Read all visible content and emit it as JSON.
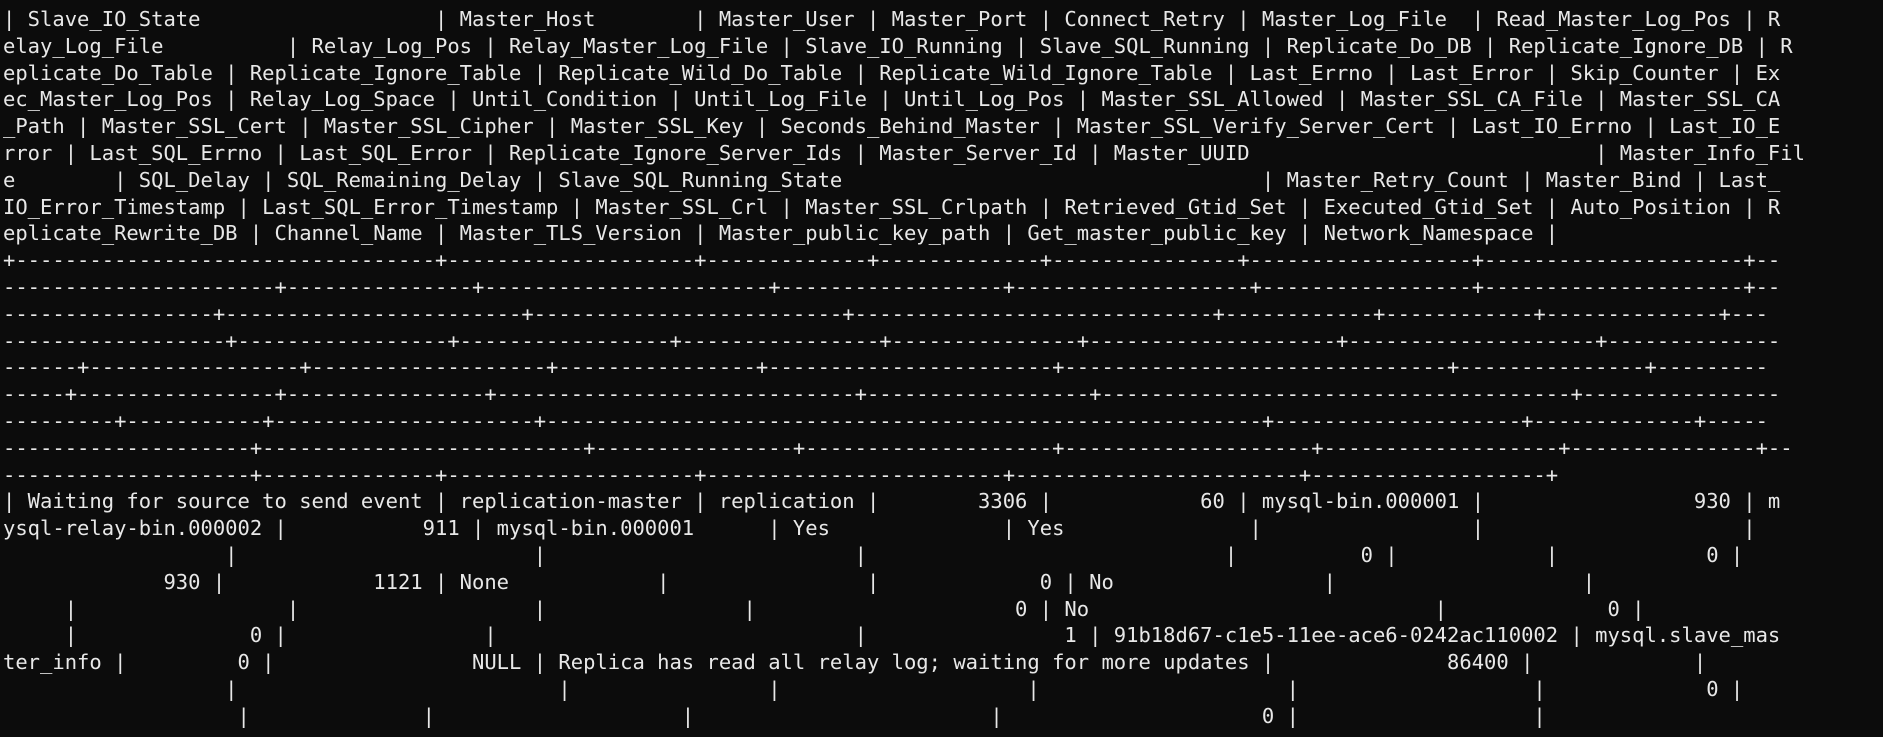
{
  "terminal": {
    "background": "#0c0c0c",
    "foreground": "#e8e8e8",
    "lines": [
      "| Slave_IO_State                   | Master_Host        | Master_User | Master_Port | Connect_Retry | Master_Log_File  | Read_Master_Log_Pos | R",
      "elay_Log_File          | Relay_Log_Pos | Relay_Master_Log_File | Slave_IO_Running | Slave_SQL_Running | Replicate_Do_DB | Replicate_Ignore_DB | R",
      "eplicate_Do_Table | Replicate_Ignore_Table | Replicate_Wild_Do_Table | Replicate_Wild_Ignore_Table | Last_Errno | Last_Error | Skip_Counter | Ex",
      "ec_Master_Log_Pos | Relay_Log_Space | Until_Condition | Until_Log_File | Until_Log_Pos | Master_SSL_Allowed | Master_SSL_CA_File | Master_SSL_CA",
      "_Path | Master_SSL_Cert | Master_SSL_Cipher | Master_SSL_Key | Seconds_Behind_Master | Master_SSL_Verify_Server_Cert | Last_IO_Errno | Last_IO_E",
      "rror | Last_SQL_Errno | Last_SQL_Error | Replicate_Ignore_Server_Ids | Master_Server_Id | Master_UUID                            | Master_Info_Fil",
      "e        | SQL_Delay | SQL_Remaining_Delay | Slave_SQL_Running_State                                  | Master_Retry_Count | Master_Bind | Last_",
      "IO_Error_Timestamp | Last_SQL_Error_Timestamp | Master_SSL_Crl | Master_SSL_Crlpath | Retrieved_Gtid_Set | Executed_Gtid_Set | Auto_Position | R",
      "eplicate_Rewrite_DB | Channel_Name | Master_TLS_Version | Master_public_key_path | Get_master_public_key | Network_Namespace |",
      "+----------------------------------+--------------------+-------------+-------------+---------------+------------------+---------------------+--",
      "----------------------+---------------+-----------------------+------------------+-------------------+-----------------+---------------------+--",
      "-----------------+------------------------+-------------------------+-----------------------------+------------+------------+--------------+---",
      "------------------+-----------------+-----------------+----------------+---------------+--------------------+--------------------+--------------",
      "------+-----------------+-------------------+----------------+-----------------------+-------------------------------+---------------+---------",
      "-----+----------------+----------------+-----------------------------+------------------+--------------------------------------+----------------",
      "---------+-----------+---------------------+----------------------------------------------------------+--------------------+-------------+-----",
      "--------------------+--------------------------+----------------+--------------------+--------------------+-------------------+---------------+--",
      "--------------------+--------------+--------------------+------------------------+-----------------------+-------------------+",
      "| Waiting for source to send event | replication-master | replication |        3306 |            60 | mysql-bin.000001 |                 930 | m",
      "ysql-relay-bin.000002 |           911 | mysql-bin.000001      | Yes              | Yes               |                 |                     |",
      "                  |                        |                         |                             |          0 |            |            0 |",
      "             930 |            1121 | None            |                |             0 | No                 |                    |",
      "     |                 |                   |                |                     0 | No                            |             0 |",
      "     |              0 |                |                             |                1 | 91b18d67-c1e5-11ee-ace6-0242ac110002 | mysql.slave_mas",
      "ter_info |         0 |                NULL | Replica has read all relay log; waiting for more updates |              86400 |             |",
      "                  |                          |                |                    |                    |                   |             0 |",
      "                   |              |                    |                        |                     0 |                   |"
    ]
  }
}
